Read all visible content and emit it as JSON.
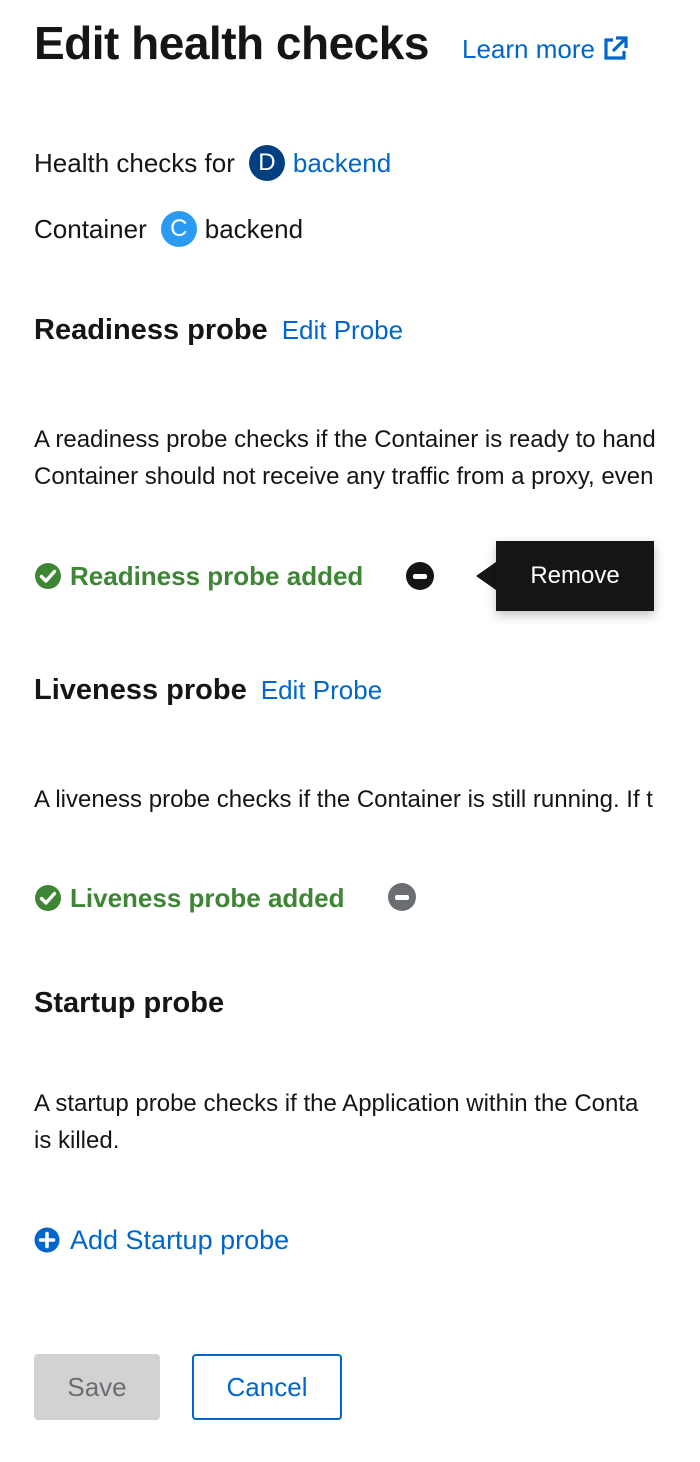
{
  "header": {
    "title": "Edit health checks",
    "learn_more": "Learn more"
  },
  "context": {
    "health_checks_label": "Health checks for",
    "deployment_badge": "D",
    "deployment_name": "backend",
    "container_label": "Container",
    "container_badge": "C",
    "container_name": "backend"
  },
  "readiness": {
    "title": "Readiness probe",
    "edit_label": "Edit Probe",
    "desc_line1": "A readiness probe checks if the Container is ready to hand",
    "desc_line2": "Container should not receive any traffic from a proxy, even",
    "status": "Readiness probe added",
    "tooltip": "Remove"
  },
  "liveness": {
    "title": "Liveness probe",
    "edit_label": "Edit Probe",
    "desc_line1": "A liveness probe checks if the Container is still running. If t",
    "status": "Liveness probe added"
  },
  "startup": {
    "title": "Startup probe",
    "desc_line1": "A startup probe checks if the Application within the Conta",
    "desc_line2": "is killed.",
    "add_label": "Add Startup probe"
  },
  "actions": {
    "save": "Save",
    "cancel": "Cancel"
  },
  "colors": {
    "link": "#0066cc",
    "success": "#3e8635",
    "tooltip_bg": "#151515",
    "disabled_bg": "#d2d2d2"
  },
  "icons": {
    "learn_more": "external-link-icon",
    "status": "check-circle-icon",
    "remove": "minus-circle-icon",
    "add": "plus-circle-icon"
  }
}
